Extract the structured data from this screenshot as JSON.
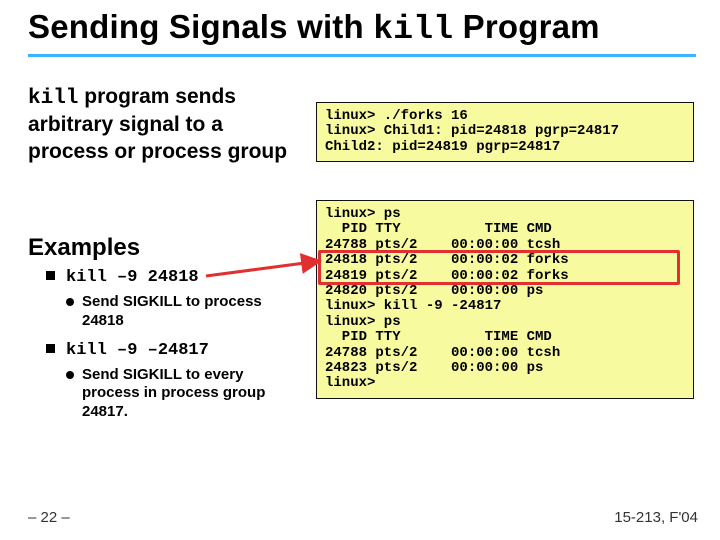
{
  "title": {
    "pre": "Sending Signals with ",
    "code": "kill",
    "post": " Program"
  },
  "para1": {
    "code": "kill",
    "rest": " program sends arbitrary signal to a process or process group"
  },
  "examples_label": "Examples",
  "bullets": [
    {
      "cmd": "kill –9 24818",
      "sub": "Send SIGKILL to process 24818"
    },
    {
      "cmd": "kill –9 –24817",
      "sub": "Send SIGKILL to every process in process group 24817."
    }
  ],
  "code1": "linux> ./forks 16\nlinux> Child1: pid=24818 pgrp=24817\nChild2: pid=24819 pgrp=24817",
  "code2": "linux> ps\n  PID TTY          TIME CMD\n24788 pts/2    00:00:00 tcsh\n24818 pts/2    00:00:02 forks\n24819 pts/2    00:00:02 forks\n24820 pts/2    00:00:00 ps\nlinux> kill -9 -24817\nlinux> ps\n  PID TTY          TIME CMD\n24788 pts/2    00:00:00 tcsh\n24823 pts/2    00:00:00 ps\nlinux>",
  "footer": {
    "left": "– 22 –",
    "right": "15-213, F'04"
  }
}
